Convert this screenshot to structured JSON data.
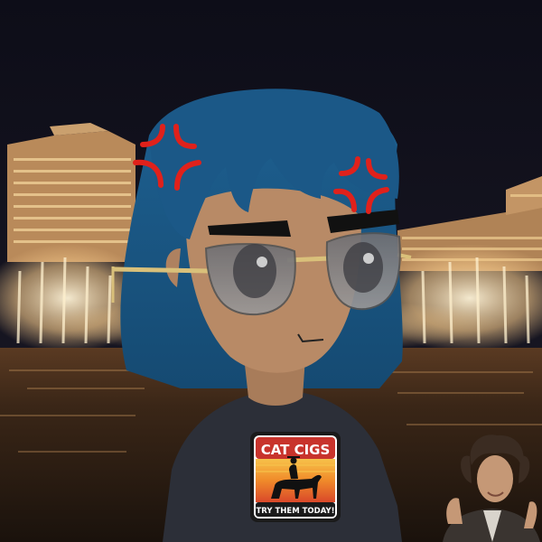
{
  "badge": {
    "title": "CAT CIGS",
    "tagline": "TRY THEM TODAY!"
  },
  "colors": {
    "sky": "#10101c",
    "water": "#2a1e16",
    "hair": "#1d5b86",
    "skin": "#b88a66",
    "shirt": "#2c2f38",
    "anger": "#e0211b",
    "glasses_frame": "#d9c07a",
    "badge_red": "#c8342c",
    "badge_orange": "#f08a2a"
  },
  "icons": [
    "anger-mark-icon",
    "horse-rider-icon",
    "sunglasses-icon"
  ]
}
